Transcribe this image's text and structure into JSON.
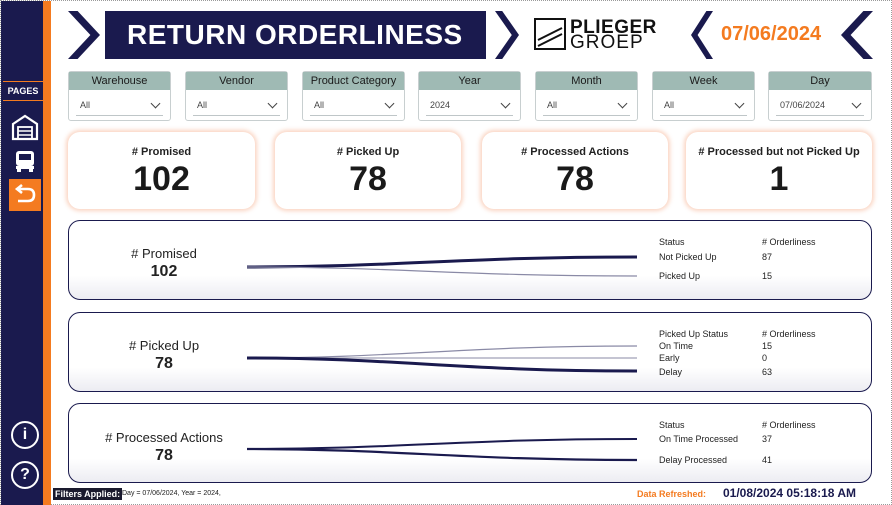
{
  "nav": {
    "pages_label": "PAGES",
    "info_symbol": "i",
    "help_symbol": "?",
    "items": [
      {
        "icon": "warehouse-icon"
      },
      {
        "icon": "truck-icon"
      },
      {
        "icon": "return-arrow-icon"
      }
    ]
  },
  "header": {
    "title": "RETURN ORDERLINESS",
    "logo_line1": "PLIEGER",
    "logo_line2": "GROEP",
    "date": "07/06/2024"
  },
  "slicers": [
    {
      "title": "Warehouse",
      "value": "All"
    },
    {
      "title": "Vendor",
      "value": "All"
    },
    {
      "title": "Product Category",
      "value": "All"
    },
    {
      "title": "Year",
      "value": "2024"
    },
    {
      "title": "Month",
      "value": "All"
    },
    {
      "title": "Week",
      "value": "All"
    },
    {
      "title": "Day",
      "value": "07/06/2024"
    }
  ],
  "kpis": [
    {
      "label": "# Promised",
      "value": "102"
    },
    {
      "label": "# Picked Up",
      "value": "78"
    },
    {
      "label": "# Processed Actions",
      "value": "78"
    },
    {
      "label": "# Processed but not Picked Up",
      "value": "1"
    }
  ],
  "panels": [
    {
      "label": "# Promised",
      "value": "102",
      "status_header": "Status",
      "count_header": "# Orderliness",
      "rows": [
        {
          "status": "Not Picked Up",
          "count": "87"
        },
        {
          "status": "Picked Up",
          "count": "15"
        }
      ]
    },
    {
      "label": "# Picked Up",
      "value": "78",
      "status_header": "Picked Up Status",
      "count_header": "# Orderliness",
      "rows": [
        {
          "status": "On Time",
          "count": "15"
        },
        {
          "status": "Early",
          "count": "0"
        },
        {
          "status": "Delay",
          "count": "63"
        }
      ]
    },
    {
      "label": "# Processed Actions",
      "value": "78",
      "status_header": "Status",
      "count_header": "# Orderliness",
      "rows": [
        {
          "status": "On Time Processed",
          "count": "37"
        },
        {
          "status": "Delay Processed",
          "count": "41"
        }
      ]
    }
  ],
  "footer": {
    "filters_label": "Filters Applied:",
    "filters_text": "Day = 07/06/2024, Year = 2024,",
    "refresh_label": "Data Refreshed:",
    "refresh_value": "01/08/2024 05:18:18 AM"
  },
  "colors": {
    "navy": "#1a1a4e",
    "orange": "#f47b20",
    "slicer_header": "#9fbab4"
  }
}
